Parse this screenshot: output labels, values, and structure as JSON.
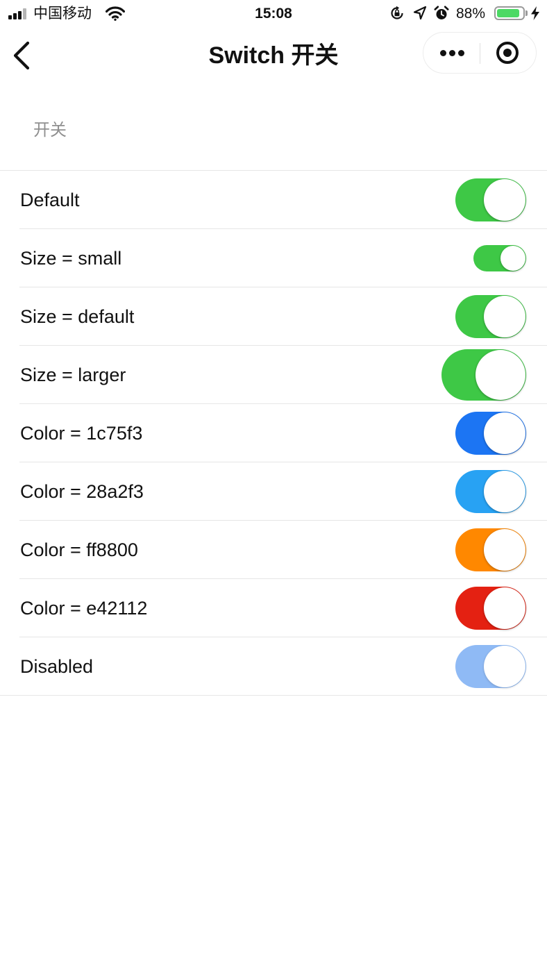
{
  "status_bar": {
    "carrier": "中国移动",
    "time": "15:08",
    "battery_percent": "88%",
    "battery_level": 0.88
  },
  "nav": {
    "title": "Switch 开关"
  },
  "section": {
    "title": "开关"
  },
  "rows": [
    {
      "label": "Default",
      "size": "default",
      "color": "#3ec846",
      "checked": true,
      "disabled": false
    },
    {
      "label": "Size = small",
      "size": "small",
      "color": "#3ec846",
      "checked": true,
      "disabled": false
    },
    {
      "label": "Size = default",
      "size": "default",
      "color": "#3ec846",
      "checked": true,
      "disabled": false
    },
    {
      "label": "Size = larger",
      "size": "larger",
      "color": "#3ec846",
      "checked": true,
      "disabled": false
    },
    {
      "label": "Color = 1c75f3",
      "size": "default",
      "color": "#1c75f3",
      "checked": true,
      "disabled": false
    },
    {
      "label": "Color = 28a2f3",
      "size": "default",
      "color": "#28a2f3",
      "checked": true,
      "disabled": false
    },
    {
      "label": "Color = ff8800",
      "size": "default",
      "color": "#ff8800",
      "checked": true,
      "disabled": false
    },
    {
      "label": "Color = e42112",
      "size": "default",
      "color": "#e42112",
      "checked": true,
      "disabled": false
    },
    {
      "label": "Disabled",
      "size": "default",
      "color": "#8fbaf5",
      "checked": true,
      "disabled": true
    }
  ]
}
